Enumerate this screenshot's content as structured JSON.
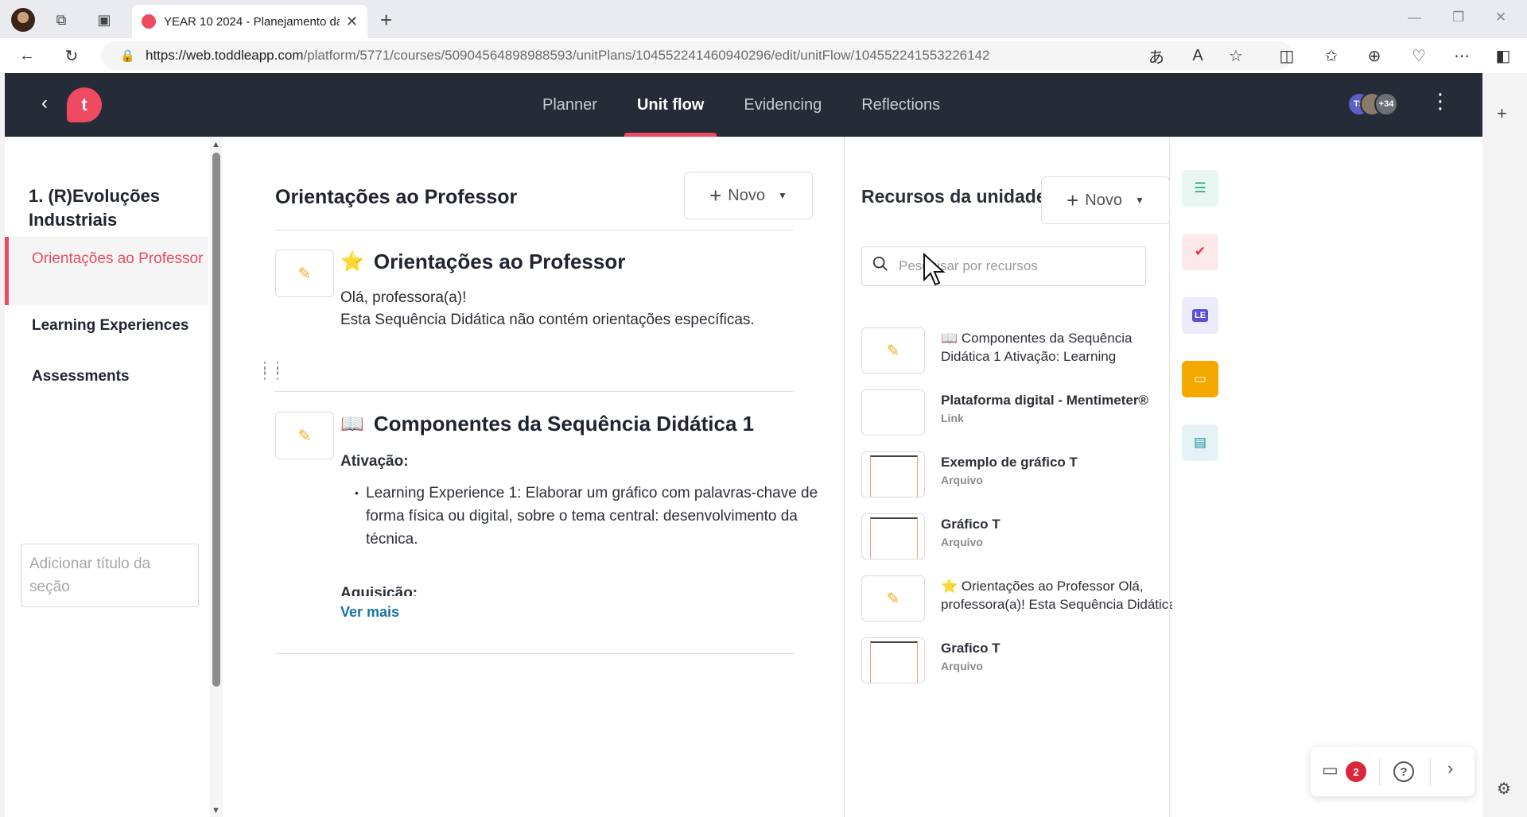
{
  "browser": {
    "tab_title": "YEAR 10 2024 - Planejamento da",
    "url_host": "https://web.toddleapp.com",
    "url_path": "/platform/5771/courses/50904564898988593/unitPlans/104552241460940296/edit/unitFlow/104552241553226142"
  },
  "topnav": {
    "tabs": [
      "Planner",
      "Unit flow",
      "Evidencing",
      "Reflections"
    ],
    "active_tab": "Unit flow",
    "avatar_initials": "TS",
    "avatar_more": "+34"
  },
  "sidebar": {
    "unit_title": "1. (R)Evoluções Industriais",
    "sections": [
      "Orientações ao Professor",
      "Learning Experiences",
      "Assessments"
    ],
    "active_section": "Orientações ao Professor",
    "add_section_placeholder": "Adicionar título da seção"
  },
  "main": {
    "title": "Orientações ao Professor",
    "new_button": "Novo",
    "cards": [
      {
        "emoji": "⭐",
        "title": "Orientações ao Professor",
        "lines": [
          "Olá, professora(a)!",
          "Esta Sequência Didática não contém orientações específicas."
        ]
      },
      {
        "emoji": "📖",
        "title": "Componentes da Sequência Didática 1",
        "subheading": "Ativação:",
        "bullet": "Learning Experience 1: Elaborar um gráfico com palavras-chave de forma física ou digital, sobre o tema central: desenvolvimento da técnica.",
        "next_heading": "Aquisição:",
        "see_more": "Ver mais"
      }
    ]
  },
  "resources": {
    "title": "Recursos da unidade",
    "new_button": "Novo",
    "search_placeholder": "Pesquisar por recursos",
    "items": [
      {
        "name": "📖 Componentes da Sequência Didática 1 Ativação: Learning",
        "sub": "",
        "thumb": "edit"
      },
      {
        "name": "Plataforma digital - Mentimeter®",
        "sub": "Link",
        "thumb": "blank"
      },
      {
        "name": "Exemplo de gráfico T",
        "sub": "Arquivo",
        "thumb": "doc"
      },
      {
        "name": "Gráfico T",
        "sub": "Arquivo",
        "thumb": "doc"
      },
      {
        "name": "⭐ Orientações ao Professor   Olá, professora(a)! Esta Sequência Didática",
        "sub": "",
        "thumb": "edit"
      },
      {
        "name": "Grafico T",
        "sub": "Arquivo",
        "thumb": "doc"
      }
    ]
  },
  "rail": {
    "colors": [
      "#1fa37a",
      "#e8334a",
      "#5b4fd9",
      "#f5a800",
      "#1c8fa3"
    ],
    "icons": [
      "notes-icon",
      "clipboard-check-icon",
      "le-icon",
      "archive-icon",
      "clipboard-icon"
    ],
    "le_label": "LE"
  },
  "help": {
    "comment_count": "2",
    "question_mark": "?"
  }
}
